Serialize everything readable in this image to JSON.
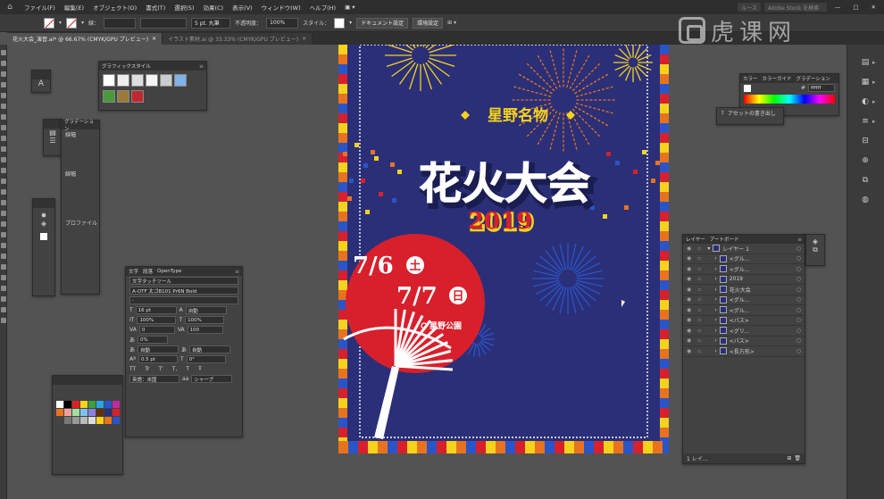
{
  "menubar": {
    "items": [
      "ファイル(F)",
      "編集(E)",
      "オブジェクト(O)",
      "書式(T)",
      "選択(S)",
      "効果(C)",
      "表示(V)",
      "ウィンドウ(W)",
      "ヘルプ(H)"
    ],
    "workspace": "ルース",
    "search_placeholder": "Adobe Stock を検索"
  },
  "controlbar": {
    "stroke_label": "線：",
    "brush_value": "5 pt. 丸筆",
    "opacity_label": "不透明度：",
    "opacity_value": "100%",
    "style_label": "スタイル：",
    "doc_setup_button": "ドキュメント設定",
    "prefs_button": "環境設定"
  },
  "tabs": [
    {
      "label": "花火大会_演習.ai* @ 66.67% (CMYK/GPU プレビュー)",
      "active": true
    },
    {
      "label": "イラスト素材.ai @ 33.33% (CMYK/GPU プレビュー)",
      "active": false
    }
  ],
  "graphic_styles_panel": {
    "title": "グラフィックスタイル"
  },
  "gradient_panel": {
    "title": "グラデーション",
    "rows": [
      "線幅",
      "",
      "",
      "",
      "線幅",
      "",
      "",
      "",
      "",
      "プロファイル"
    ]
  },
  "character_panel": {
    "tabs": [
      "文字",
      "段落",
      "OpenType"
    ],
    "touch_tool": "文字タッチツール",
    "font_family": "A-OTF 太ゴB101 Pr6N Bold",
    "font_style": "-",
    "size": "16 pt",
    "leading": "自動",
    "vscale": "100%",
    "hscale": "100%",
    "kern": "0",
    "tracking": "100",
    "tsume": "0%",
    "aki_left": "自動",
    "aki_right": "自動",
    "baseline": "0.5 pt",
    "rotation": "0°",
    "language": "英語：米国",
    "aa": "シャープ",
    "char_btns": [
      "TT",
      "Tr",
      "T'",
      "T,",
      "T",
      "Ŧ"
    ]
  },
  "color_panel": {
    "tabs": [
      "カラー",
      "カラーガイド",
      "グラデーション"
    ],
    "hex": "ffffff"
  },
  "asset_panel": {
    "export_label": "アセットの書き出し"
  },
  "layers_panel": {
    "tabs": [
      "レイヤー",
      "アートボード"
    ],
    "layers": [
      {
        "name": "レイヤー 1",
        "level": 0,
        "expanded": true
      },
      {
        "name": "<グル...",
        "level": 1,
        "expanded": false
      },
      {
        "name": "<グル...",
        "level": 1,
        "expanded": false
      },
      {
        "name": "2019",
        "level": 1,
        "expanded": false
      },
      {
        "name": "花火大会",
        "level": 1,
        "expanded": false
      },
      {
        "name": "<グル...",
        "level": 1,
        "expanded": false
      },
      {
        "name": "<グル...",
        "level": 1,
        "expanded": false
      },
      {
        "name": "<パス>",
        "level": 1,
        "expanded": false
      },
      {
        "name": "<グリ...",
        "level": 1,
        "expanded": false
      },
      {
        "name": "<パス>",
        "level": 1,
        "expanded": false
      },
      {
        "name": "<長方形>",
        "level": 1,
        "expanded": false
      }
    ],
    "footer": "1 レイ..."
  },
  "poster": {
    "subtitle": "星野名物",
    "title": "花火大会",
    "year": "2019",
    "date1": "7/6",
    "day1": "土",
    "date2": "7/7",
    "day2": "日",
    "venue": "星野公園",
    "colors": {
      "navy": "#2a2f78",
      "red": "#d7202c",
      "yellow": "#f7d21c",
      "orange": "#e8731f",
      "blue": "#2a55c8"
    }
  },
  "watermark": {
    "text": "虎课网"
  }
}
